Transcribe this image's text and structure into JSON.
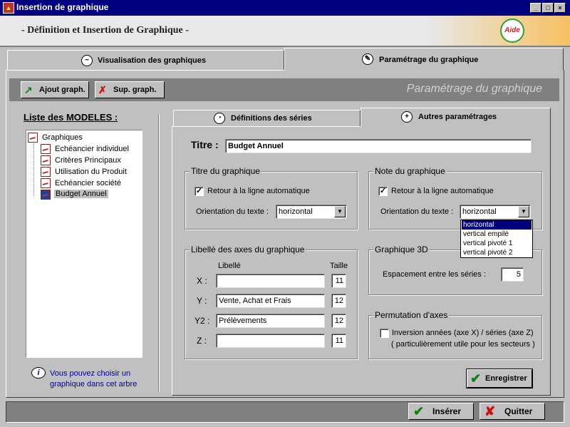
{
  "window": {
    "title": "Insertion de graphique"
  },
  "header": {
    "title": "- Définition et Insertion de Graphique -",
    "help_label": "Aide"
  },
  "main_tabs": [
    {
      "label": "Visualisation des graphiques",
      "icon": "line-chart-icon"
    },
    {
      "label": "Paramétrage du graphique",
      "icon": "wrench-icon",
      "active": true
    }
  ],
  "toolbar": {
    "add_label": "Ajout graph.",
    "delete_label": "Sup. graph.",
    "caption": "Paramétrage du graphique"
  },
  "tree": {
    "title": "Liste des MODELES :",
    "root": "Graphiques",
    "items": [
      {
        "label": "Echéancier individuel"
      },
      {
        "label": "Critères Principaux"
      },
      {
        "label": "Utilisation du Produit"
      },
      {
        "label": "Echéancier société"
      },
      {
        "label": "Budget Annuel",
        "selected": true
      }
    ]
  },
  "hint": "Vous pouvez choisir un graphique dans cet arbre",
  "sub_tabs": [
    {
      "label": "Définitions des séries"
    },
    {
      "label": "Autres paramétrages",
      "active": true
    }
  ],
  "form": {
    "title_label": "Titre :",
    "title_value": "Budget Annuel",
    "chart_title_group": {
      "legend": "Titre du graphique",
      "wrap_label": "Retour à la ligne automatique",
      "wrap_checked": true,
      "orientation_label": "Orientation du texte :",
      "orientation_value": "horizontal"
    },
    "chart_note_group": {
      "legend": "Note du graphique",
      "wrap_label": "Retour à la ligne automatique",
      "wrap_checked": true,
      "orientation_label": "Orientation du texte :",
      "orientation_value": "horizontal",
      "options": [
        "horizontal",
        "vertical empilé",
        "vertical pivoté 1",
        "vertical pivoté 2"
      ]
    },
    "axes_group": {
      "legend": "Libellé des axes du graphique",
      "col_label": "Libellé",
      "col_size": "Taille",
      "axes": [
        {
          "name": "X :",
          "label": "",
          "size": "11"
        },
        {
          "name": "Y :",
          "label": "Vente, Achat et Frais",
          "size": "12"
        },
        {
          "name": "Y2 :",
          "label": "Prélèvements",
          "size": "12"
        },
        {
          "name": "Z :",
          "label": "",
          "size": "11"
        }
      ]
    },
    "graph3d_group": {
      "legend": "Graphique 3D",
      "spacing_label": "Espacement entre les séries :",
      "spacing_value": "5"
    },
    "permutation_group": {
      "legend": "Permutation d'axes",
      "checkbox_label": "Inversion années (axe X) / séries (axe Z)",
      "note": "( particulièrement utile pour les secteurs )",
      "checked": false
    },
    "save_label": "Enregistrer"
  },
  "footer": {
    "insert_label": "Insérer",
    "quit_label": "Quitter"
  },
  "colors": {
    "titlebar": "#000080",
    "selection": "#000080",
    "face": "#c0c0c0",
    "hint_text": "#0000a0"
  }
}
